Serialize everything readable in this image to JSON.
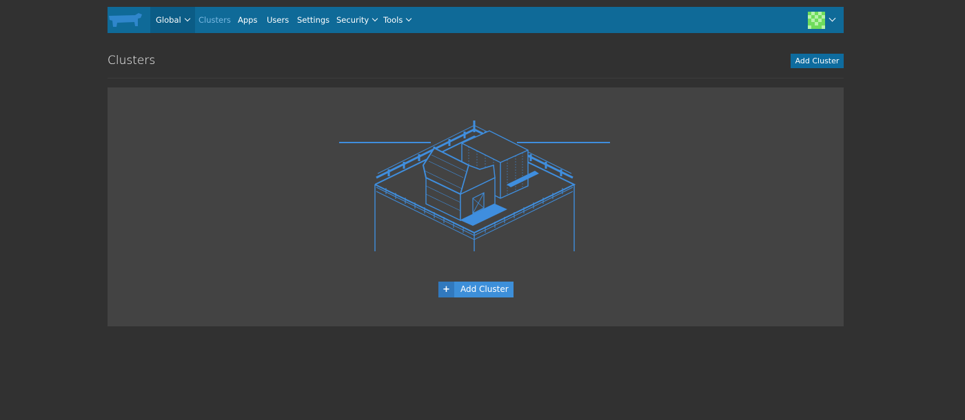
{
  "nav": {
    "logo": "rancher-cow-logo",
    "global_label": "Global",
    "items": [
      {
        "label": "Clusters",
        "active": true
      },
      {
        "label": "Apps"
      },
      {
        "label": "Users"
      },
      {
        "label": "Settings"
      },
      {
        "label": "Security",
        "dropdown": true
      },
      {
        "label": "Tools",
        "dropdown": true
      }
    ],
    "user_menu": "user-avatar"
  },
  "page": {
    "title": "Clusters",
    "header_button": "Add Cluster"
  },
  "empty_state": {
    "illustration": "farm-barn-illustration",
    "add_button_icon": "+",
    "add_button_label": "Add Cluster"
  },
  "colors": {
    "background": "#313131",
    "nav": "#0f6a98",
    "panel": "#434343",
    "accent": "#3d8fd9",
    "active_link": "#79b8e2"
  }
}
